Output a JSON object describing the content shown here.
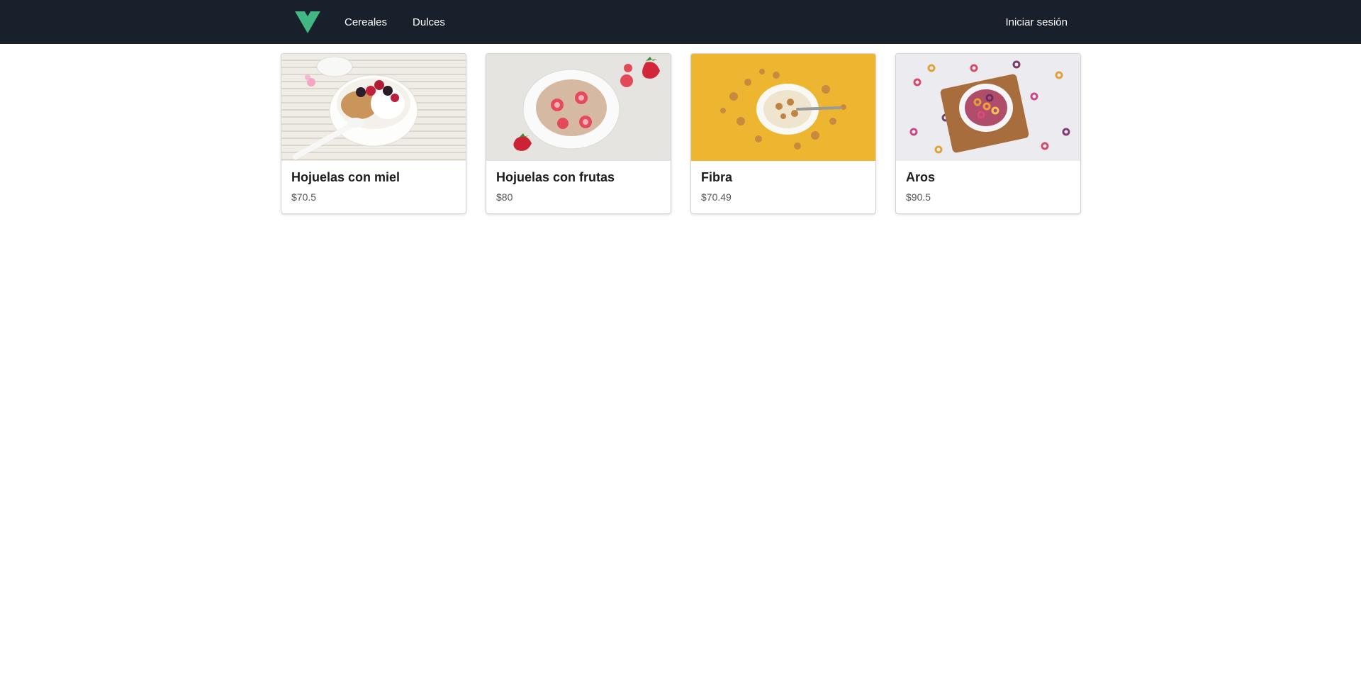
{
  "nav": {
    "logo": "vue-logo-icon",
    "links": [
      "Cereales",
      "Dulces"
    ],
    "login": "Iniciar sesión"
  },
  "products": [
    {
      "name": "Hojuelas con miel",
      "price": "$70.5",
      "image": "granola-yogurt-berries-bowl"
    },
    {
      "name": "Hojuelas con frutas",
      "price": "$80",
      "image": "oatmeal-strawberries-bowl"
    },
    {
      "name": "Fibra",
      "price": "$70.49",
      "image": "cornflakes-bowl-yellow-background"
    },
    {
      "name": "Aros",
      "price": "$90.5",
      "image": "fruit-loops-bowl-wooden-board"
    }
  ],
  "colors": {
    "navbar_bg": "#18202b",
    "vue_green": "#41b883",
    "vue_dark": "#34495e"
  }
}
